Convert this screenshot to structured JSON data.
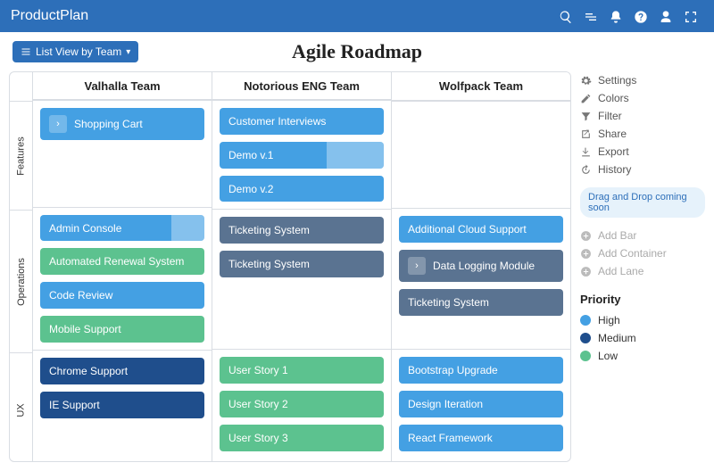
{
  "brand": "ProductPlan",
  "title": "Agile Roadmap",
  "view_selector": "List View by Team",
  "columns": [
    "Valhalla Team",
    "Notorious ENG Team",
    "Wolfpack Team"
  ],
  "lanes": [
    "Features",
    "Operations",
    "UX"
  ],
  "bars": {
    "valhalla": {
      "features": [
        {
          "label": "Shopping Cart",
          "color": "high",
          "expand": true
        }
      ],
      "operations": [
        {
          "label": "Admin Console",
          "color": "high",
          "progress": 20
        },
        {
          "label": "Automated Renewal System",
          "color": "low"
        },
        {
          "label": "Code Review",
          "color": "high"
        },
        {
          "label": "Mobile Support",
          "color": "low"
        }
      ],
      "ux": [
        {
          "label": "Chrome Support",
          "color": "medium"
        },
        {
          "label": "IE Support",
          "color": "medium"
        }
      ]
    },
    "notorious": {
      "features": [
        {
          "label": "Customer Interviews",
          "color": "high"
        },
        {
          "label": "Demo v.1",
          "color": "high",
          "progress": 35
        },
        {
          "label": "Demo v.2",
          "color": "high"
        }
      ],
      "operations": [
        {
          "label": "Ticketing System",
          "color": "slate"
        },
        {
          "label": "Ticketing System",
          "color": "slate"
        }
      ],
      "ux": [
        {
          "label": "User Story 1",
          "color": "low"
        },
        {
          "label": "User Story 2",
          "color": "low"
        },
        {
          "label": "User Story 3",
          "color": "low"
        }
      ]
    },
    "wolfpack": {
      "features": [],
      "operations": [
        {
          "label": "Additional Cloud Support",
          "color": "high"
        },
        {
          "label": "Data Logging Module",
          "color": "slate",
          "expand": true
        },
        {
          "label": "Ticketing System",
          "color": "slate"
        }
      ],
      "ux": [
        {
          "label": "Bootstrap Upgrade",
          "color": "high"
        },
        {
          "label": "Design Iteration",
          "color": "high"
        },
        {
          "label": "React Framework",
          "color": "high"
        }
      ]
    }
  },
  "side": {
    "settings": "Settings",
    "colors": "Colors",
    "filter": "Filter",
    "share": "Share",
    "export": "Export",
    "history": "History",
    "tag": "Drag and Drop coming soon",
    "add_bar": "Add Bar",
    "add_container": "Add Container",
    "add_lane": "Add Lane"
  },
  "legend": {
    "title": "Priority",
    "items": [
      {
        "label": "High",
        "color": "#44a0e3"
      },
      {
        "label": "Medium",
        "color": "#1f4e8c"
      },
      {
        "label": "Low",
        "color": "#5cc28f"
      }
    ]
  }
}
